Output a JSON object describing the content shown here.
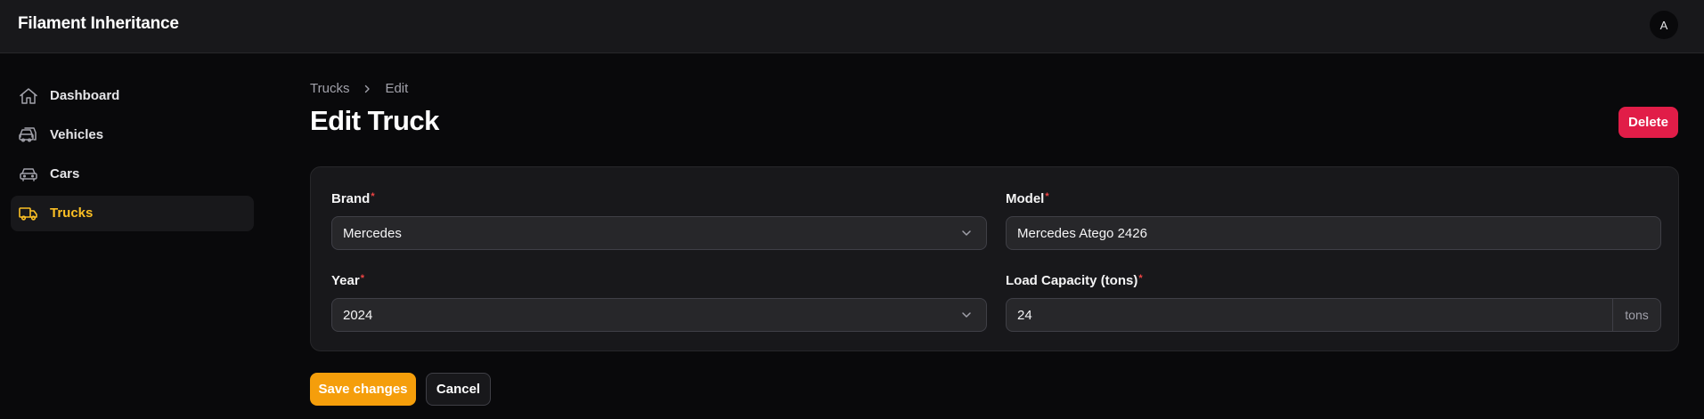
{
  "app": {
    "title": "Filament Inheritance",
    "avatar_initial": "A"
  },
  "sidebar": {
    "items": [
      {
        "label": "Dashboard",
        "icon": "home-icon",
        "active": false
      },
      {
        "label": "Vehicles",
        "icon": "vehicles-icon",
        "active": false
      },
      {
        "label": "Cars",
        "icon": "car-icon",
        "active": false
      },
      {
        "label": "Trucks",
        "icon": "truck-icon",
        "active": true
      }
    ]
  },
  "breadcrumb": {
    "items": [
      "Trucks",
      "Edit"
    ]
  },
  "page": {
    "title": "Edit Truck",
    "delete_label": "Delete"
  },
  "form": {
    "brand": {
      "label": "Brand",
      "value": "Mercedes",
      "required": true
    },
    "model": {
      "label": "Model",
      "value": "Mercedes Atego 2426",
      "required": true
    },
    "year": {
      "label": "Year",
      "value": "2024",
      "required": true
    },
    "load_capacity": {
      "label": "Load Capacity (tons)",
      "value": "24",
      "suffix": "tons",
      "required": true
    },
    "required_marker": "*"
  },
  "actions": {
    "save_label": "Save changes",
    "cancel_label": "Cancel"
  },
  "colors": {
    "accent": "#f59e0b",
    "active_nav": "#fbbf24",
    "danger": "#e11d48",
    "background": "#09090b",
    "surface": "#18181b"
  }
}
